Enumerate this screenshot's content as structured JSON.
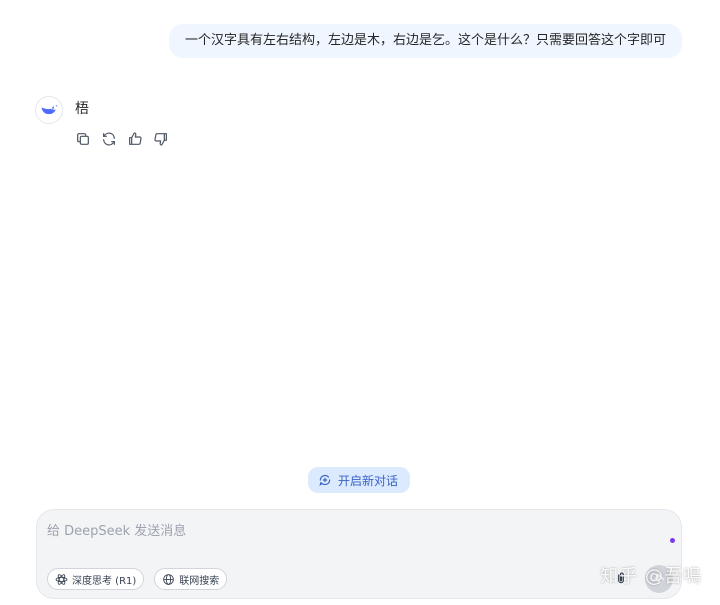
{
  "conversation": {
    "user_message": "一个汉字具有左右结构，左边是木，右边是乞。这个是什么？只需要回答这个字即可",
    "assistant_answer": "梧"
  },
  "message_actions": [
    {
      "name": "copy-icon"
    },
    {
      "name": "regenerate-icon"
    },
    {
      "name": "thumbs-up-icon"
    },
    {
      "name": "thumbs-down-icon"
    }
  ],
  "new_chat": {
    "label": "开启新对话"
  },
  "composer": {
    "placeholder": "给 DeepSeek 发送消息",
    "deep_think_label": "深度思考 (R1)",
    "web_search_label": "联网搜索"
  },
  "watermark": {
    "text": "知乎 @吾鳴"
  },
  "colors": {
    "user_bubble": "#eff6ff",
    "accent": "#4d6bfe",
    "new_chat_bg": "#dbeafe"
  }
}
